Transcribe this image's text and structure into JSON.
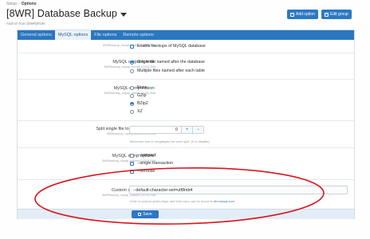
{
  "breadcrumb": {
    "items": [
      "Setup",
      "Options"
    ]
  },
  "header": {
    "title": "[8WR] Database Backup",
    "addon_line": "Add-on from [8WR]RUN",
    "add_option_label": "Add option",
    "edit_group_label": "Edit group",
    "accent_color": "#2c78c4"
  },
  "tabs": [
    {
      "label": "General options"
    },
    {
      "label": "MySQL options"
    },
    {
      "label": "File options"
    },
    {
      "label": "Remote options"
    }
  ],
  "active_tab": "MySQL options",
  "enable_backup": {
    "sub": "8WRbackup_mysql_enable (2095)",
    "edit": "Edit",
    "label": "Enable backups of MySQL database",
    "checked": true
  },
  "output_format": {
    "label": "MySQL output format:",
    "sub": "8WRbackup_mysql_format (2111)",
    "edit": "Edit",
    "options": [
      {
        "label": "Single file named after the database",
        "selected": true
      },
      {
        "label": "Multiple files named after each table",
        "selected": false
      }
    ]
  },
  "compression": {
    "label": "MySQL compression:",
    "sub": "8WRbackup_mysql_deline (2103)",
    "edit": "Edit",
    "options": [
      {
        "label": "None",
        "selected": false
      },
      {
        "label": "GZip",
        "selected": false
      },
      {
        "label": "BZip2",
        "selected": true
      },
      {
        "label": "XZ",
        "selected": false
      }
    ]
  },
  "split": {
    "label": "Split single file to multiple files:",
    "sub": "8WRbackup_mysql_split (2099)",
    "edit": "Edit",
    "value": "0",
    "plus": "+",
    "minus": "−",
    "hint": "Maximum size in megabytes for each split. (0 to disable)"
  },
  "dump_options": {
    "label": "MySQL dump options:",
    "sub": "8WRbackup_mysql_options (2207)",
    "edit": "Edit",
    "options": [
      {
        "label": "--compact",
        "checked": false
      },
      {
        "label": "--single-transaction",
        "checked": true
      },
      {
        "label": "--verbose",
        "checked": true
      }
    ]
  },
  "custom_dump": {
    "label": "Custom dump options:",
    "sub": "8WRbackup_mysql_custom (2210)",
    "edit": "Edit",
    "value": "--default-character-set=utf8mb4",
    "hint_prefix": "A list of custom option flags and their uses can be found at",
    "hint_link": "dev.mysql.com"
  },
  "save_label": "Save",
  "annotation_color": "#d8141c"
}
